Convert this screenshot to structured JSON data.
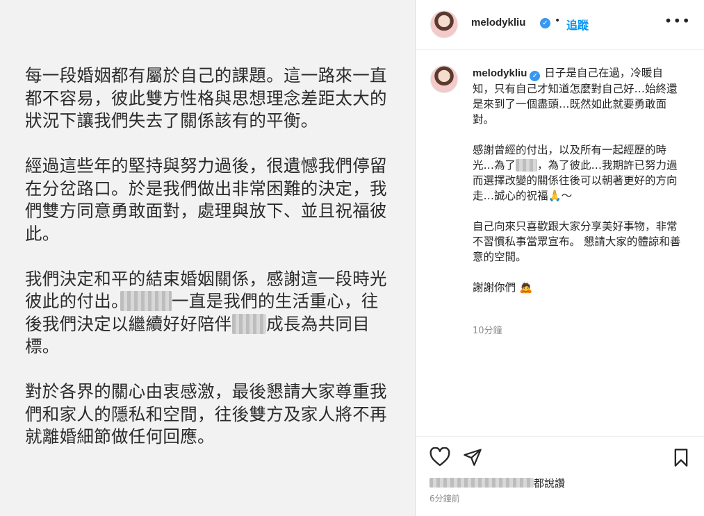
{
  "post_image": {
    "paragraphs": [
      [
        "每一段婚姻都有屬於自己的課題。這一路來一直都不容易，彼此雙方性格與思想理念差距太大的狀況下讓我們失去了關係該有的平衡。"
      ],
      [
        "經過這些年的堅持與努力過後，很遺憾我們停留在分岔路口。於是我們做出非常困難的決定，我們雙方同意勇敢面對，處理與放下、並且祝福彼此。"
      ],
      [
        "我們決定和平的結束婚姻關係，感謝這一段時光彼此的付出。",
        "一直是我們的生活重心，往後我們決定以繼續好好陪伴",
        "成長為共同目標。"
      ],
      [
        "對於各界的關心由衷感激，最後懇請大家尊重我們和家人的隱私和空間，往後雙方及家人將不再就離婚細節做任何回應。"
      ]
    ]
  },
  "header": {
    "username": "melodykliu",
    "verified_icon": "verified-badge-icon",
    "separator": "•",
    "follow_label": "追蹤",
    "more_icon": "more-options-icon",
    "more_glyph": "•••"
  },
  "caption": {
    "username": "melodykliu",
    "para1": "日子是自己在過，冷暖自知，只有自己才知道怎麼對自己好…始終還是來到了一個盡頭…既然如此就要勇敢面對。",
    "para2_a": "感謝曾經的付出，以及所有一起經歷的時光…為了",
    "para2_b": "，為了彼此…我期許已努力過而選擇改變的關係往後可以朝著更好的方向走…誠心的祝福🙏～",
    "para3": "自己向來只喜歡跟大家分享美好事物，非常不習慣私事當眾宣布。 懇請大家的體諒和善意的空間。",
    "para4": "謝謝你們",
    "para4_emoji": "🙇",
    "time": "10分鐘"
  },
  "actions": {
    "like_icon": "heart-icon",
    "share_icon": "send-icon",
    "save_icon": "bookmark-icon",
    "likes_suffix": "都說讚",
    "posted_ago": "6分鐘前"
  },
  "colors": {
    "link_blue": "#0095f6",
    "verified_blue": "#3897f0",
    "muted_gray": "#8e8e8e",
    "image_bg": "#f2f2f2"
  }
}
